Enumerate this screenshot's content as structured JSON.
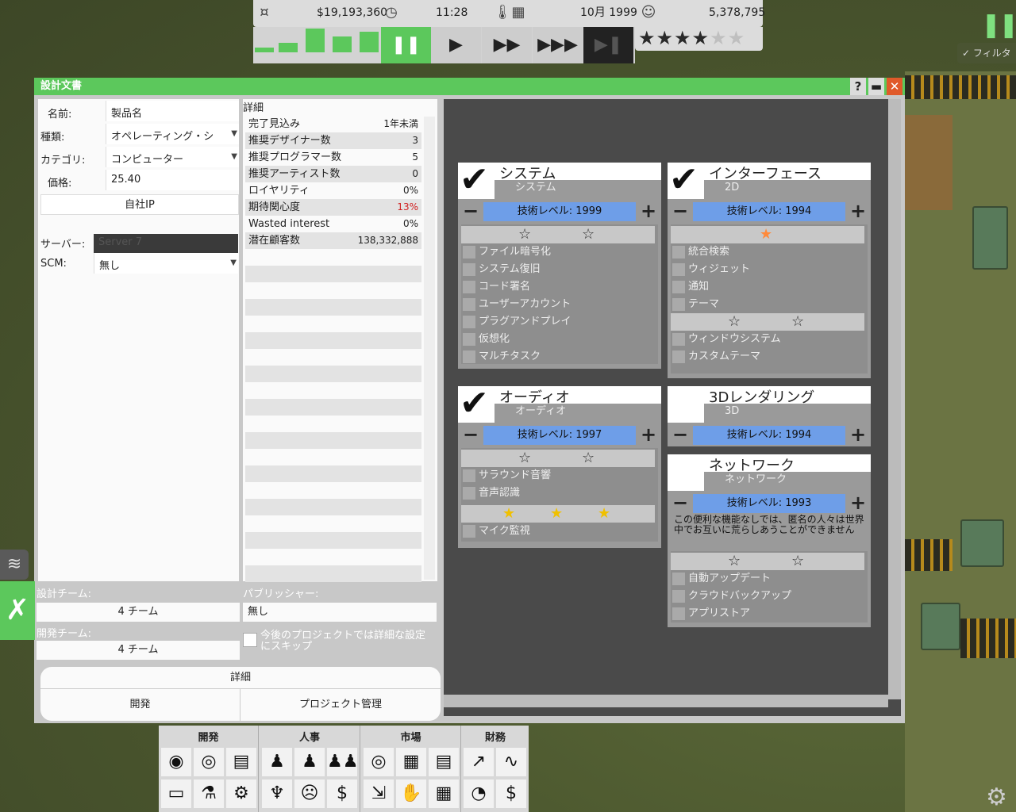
{
  "topbar": {
    "money": "$19,193,360",
    "time": "11:28",
    "date": "10月 1999",
    "fans": "5,378,795",
    "icons": [
      "money-icon",
      "clock-icon",
      "thermometer-icon",
      "calendar-icon",
      "smiley-icon"
    ]
  },
  "speed": {
    "pause": "⏸",
    "play": "▶",
    "fast": "⏩",
    "faster": "⏭",
    "skip": "⏭"
  },
  "rating": {
    "stars_on": 4,
    "stars_total": 6
  },
  "filter": {
    "label": "フィルタ"
  },
  "window": {
    "title": "設計文書",
    "help": "?",
    "minimize": "▬",
    "close": "✕"
  },
  "form": {
    "name_label": "名前:",
    "name_value": "製品名",
    "type_label": "種類:",
    "type_value": "オペレーティング・シ",
    "category_label": "カテゴリ:",
    "category_value": "コンピューター",
    "price_label": "価格:",
    "price_value": "25.40",
    "ip_button": "自社IP",
    "server_label": "サーバー:",
    "server_value": "Server 7",
    "scm_label": "SCM:",
    "scm_value": "無し"
  },
  "details": {
    "header": "詳細",
    "rows": [
      {
        "label": "完了見込み",
        "value": "1年未満"
      },
      {
        "label": "推奨デザイナー数",
        "value": "3"
      },
      {
        "label": "推奨プログラマー数",
        "value": "5"
      },
      {
        "label": "推奨アーティスト数",
        "value": "0"
      },
      {
        "label": "ロイヤリティ",
        "value": "0%"
      },
      {
        "label": "期待関心度",
        "value": "13%"
      },
      {
        "label": "Wasted interest",
        "value": "0%"
      },
      {
        "label": "潜在顧客数",
        "value": "138,332,888"
      }
    ]
  },
  "teams": {
    "design_label": "設計チーム:",
    "design_value": "4 チーム",
    "dev_label": "開発チーム:",
    "dev_value": "4 チーム",
    "publisher_label": "パブリッシャー:",
    "publisher_value": "無し",
    "skip_text": "今後のプロジェクトでは詳細な設定にスキップ"
  },
  "bottom": {
    "details": "詳細",
    "develop": "開発",
    "project_mgmt": "プロジェクト管理"
  },
  "panels": {
    "system": {
      "title": "システム",
      "sub": "システム",
      "tech": "技術レベル: 1999",
      "items": [
        "ファイル暗号化",
        "システム復旧",
        "コード署名",
        "ユーザーアカウント",
        "プラグアンドプレイ",
        "仮想化",
        "マルチタスク"
      ]
    },
    "interface": {
      "title": "インターフェース",
      "sub": "2D",
      "tech": "技術レベル: 1994",
      "items1": [
        "統合検索",
        "ウィジェット",
        "通知",
        "テーマ"
      ],
      "items2": [
        "ウィンドウシステム",
        "カスタムテーマ"
      ]
    },
    "audio": {
      "title": "オーディオ",
      "sub": "オーディオ",
      "tech": "技術レベル: 1997",
      "items1": [
        "サラウンド音響",
        "音声認識"
      ],
      "items2": [
        "マイク監視"
      ]
    },
    "render3d": {
      "title": "3Dレンダリング",
      "sub": "3D",
      "tech": "技術レベル: 1994"
    },
    "network": {
      "title": "ネットワーク",
      "sub": "ネットワーク",
      "tech": "技術レベル: 1993",
      "note": "この便利な機能なしでは、匿名の人々は世界中でお互いに荒らしあうことができません",
      "items": [
        "自動アップデート",
        "クラウドバックアップ",
        "アプリストア"
      ]
    }
  },
  "toolbar": {
    "groups": [
      "開発",
      "人事",
      "市場",
      "財務"
    ]
  },
  "colors": {
    "accent": "#5cc85c",
    "tech_bar": "#6e9ee8",
    "warning": "#d02020"
  }
}
